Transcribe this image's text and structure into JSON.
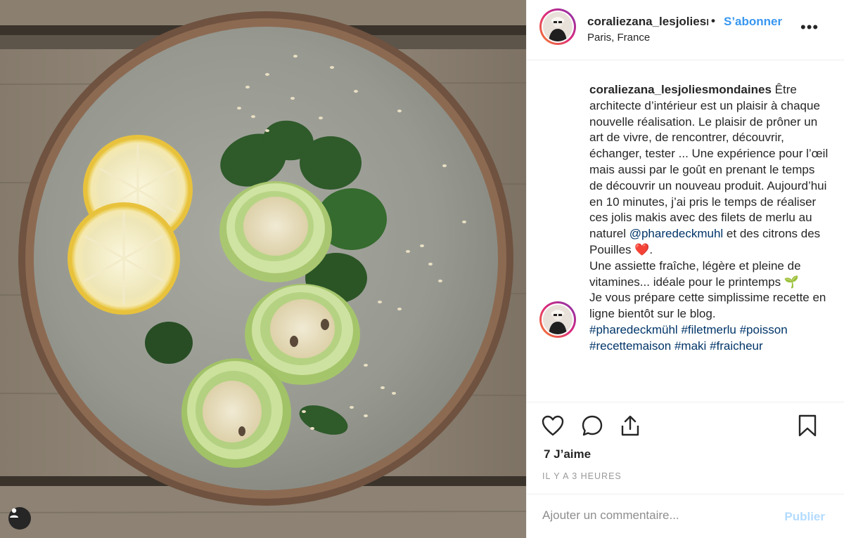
{
  "post": {
    "username": "coraliezana_lesjoliesmondaines",
    "follow_label": "S’abonner",
    "separator": "•",
    "location": "Paris, France",
    "more_label": "•••"
  },
  "caption": {
    "username": "coraliezana_lesjoliesmondaines",
    "text_1": " Être architecte d’intérieur est un plaisir à chaque nouvelle réalisation. Le plaisir de prôner un art de vivre, de rencontrer, découvrir, échanger, tester ... Une expérience pour l’œil mais aussi par le goût en prenant le temps de découvrir un nouveau produit. Aujourd’hui en 10 minutes, j’ai pris le temps de réaliser ces jolis makis avec des filets de merlu au naturel ",
    "mention": "@pharedeckmuhl",
    "text_2": " et des citrons des Pouilles ❤️.",
    "text_3": "Une assiette fraîche, légère et pleine de vitamines... idéale pour le printemps 🌱",
    "text_4": "Je vous prépare cette simplissime recette en ligne bientôt sur le blog.",
    "hashtags": [
      "#pharedeckmühl",
      "#filetmerlu",
      "#poisson",
      "#recettemaison",
      "#maki",
      "#fraicheur"
    ]
  },
  "actions": {
    "like_icon": "heart-icon",
    "comment_icon": "comment-icon",
    "share_icon": "share-icon",
    "save_icon": "bookmark-icon",
    "likes_text": "7 J’aime",
    "time_text": "IL Y A 3 HEURES"
  },
  "comment": {
    "placeholder": "Ajouter un commentaire...",
    "publish_label": "Publier"
  },
  "colors": {
    "accent": "#3897f0",
    "link": "#003569",
    "publish_disabled": "#b3dbff",
    "meta": "#999999"
  }
}
